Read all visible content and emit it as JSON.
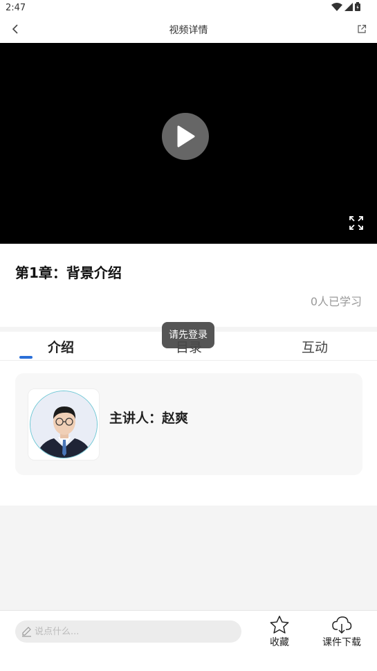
{
  "status_bar": {
    "time": "2:47"
  },
  "nav": {
    "title": "视频详情"
  },
  "chapter": {
    "title": "第1章：背景介绍",
    "learn_count": "0人已学习"
  },
  "tabs": [
    {
      "label": "介绍"
    },
    {
      "label": "目录"
    },
    {
      "label": "互动"
    }
  ],
  "tooltip": "请先登录",
  "lecturer": {
    "label": "主讲人：赵爽"
  },
  "bottom": {
    "comment_placeholder": "说点什么...",
    "favorite_label": "收藏",
    "download_label": "课件下载"
  },
  "colors": {
    "accent": "#2b6fd8",
    "video_bg": "#000000"
  }
}
